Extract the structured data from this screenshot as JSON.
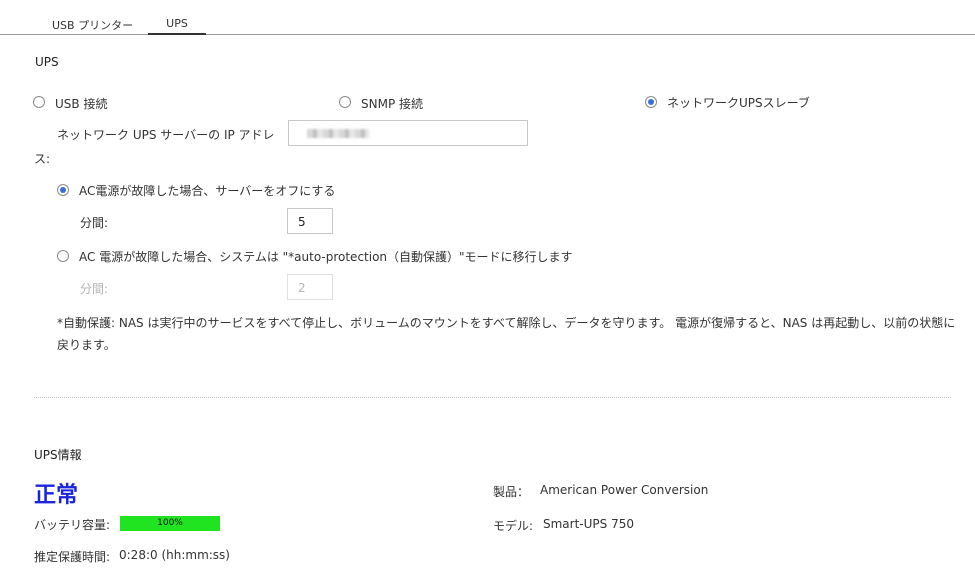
{
  "tabs": [
    {
      "label": "USB プリンター"
    },
    {
      "label": "UPS"
    }
  ],
  "ups_section": {
    "title": "UPS",
    "mode_options": [
      {
        "label": "USB 接続",
        "selected": false
      },
      {
        "label": "SNMP 接続",
        "selected": false
      },
      {
        "label": "ネットワークUPSスレーブ",
        "selected": true
      }
    ],
    "ip_label_line1": "ネットワーク UPS サーバーの IP アドレ",
    "ip_label_line2": "ス:",
    "ip_value": "",
    "option_off": {
      "label": "AC電源が故障した場合、サーバーをオフにする",
      "selected": true
    },
    "minutes_label": "分間:",
    "minutes_value": "5",
    "option_protect": {
      "label": "AC 電源が故障した場合、システムは \"*auto-protection（自動保護）\"モードに移行します",
      "selected": false
    },
    "protect_minutes_label": "分間:",
    "protect_minutes_value": "2",
    "note_text": "*自動保護: NAS は実行中のサービスをすべて停止し、ボリュームのマウントをすべて解除し、データを守ります。 電源が復帰すると、NAS は再起動し、以前の状態に戻ります。"
  },
  "ups_info": {
    "title": "UPS情報",
    "status": "正常",
    "status_color": "#1a24e0",
    "battery_label": "バッテリ容量:",
    "battery_percent": 100,
    "battery_text": "100%",
    "battery_color": "#20e420",
    "runtime_label": "推定保護時間:",
    "runtime_value": "0:28:0 (hh:mm:ss)",
    "product_label": "製品：",
    "product_value": "American Power Conversion",
    "model_label": "モデル:",
    "model_value": "Smart-UPS 750"
  }
}
